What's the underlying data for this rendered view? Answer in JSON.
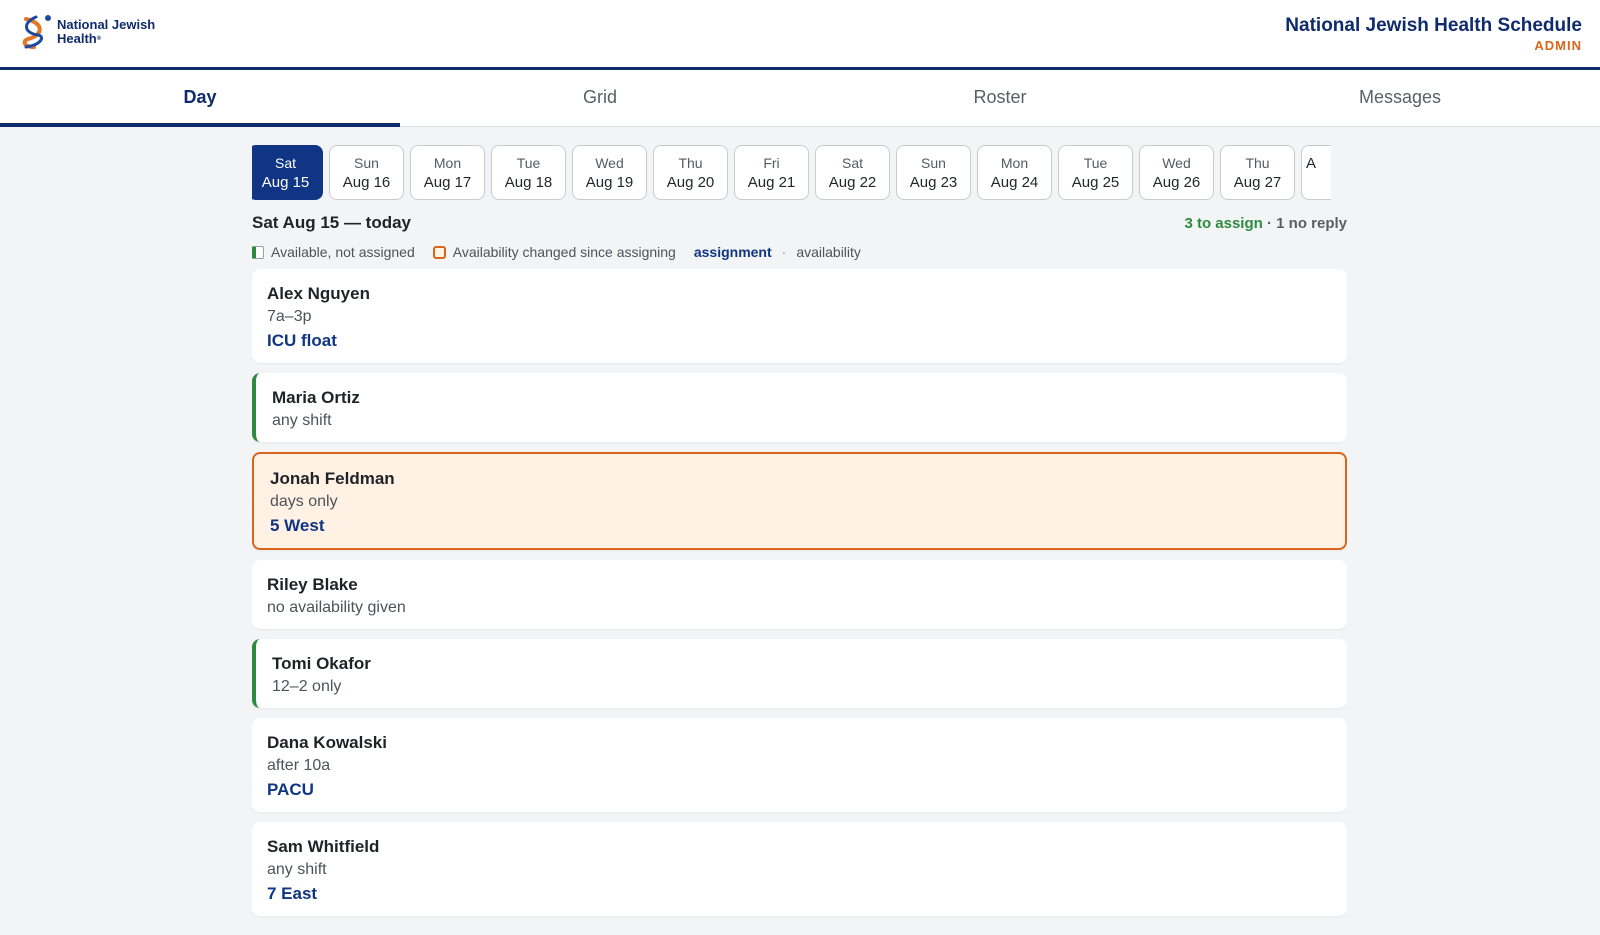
{
  "header": {
    "logo_line1": "National Jewish",
    "logo_line2": "Health",
    "logo_reg": "®",
    "title": "National Jewish Health Schedule",
    "role": "ADMIN"
  },
  "tabs": [
    {
      "label": "Day",
      "active": true
    },
    {
      "label": "Grid",
      "active": false
    },
    {
      "label": "Roster",
      "active": false
    },
    {
      "label": "Messages",
      "active": false
    }
  ],
  "dates": [
    {
      "dow": "Sat",
      "date": "Aug 15",
      "selected": true
    },
    {
      "dow": "Sun",
      "date": "Aug 16"
    },
    {
      "dow": "Mon",
      "date": "Aug 17"
    },
    {
      "dow": "Tue",
      "date": "Aug 18"
    },
    {
      "dow": "Wed",
      "date": "Aug 19"
    },
    {
      "dow": "Thu",
      "date": "Aug 20"
    },
    {
      "dow": "Fri",
      "date": "Aug 21"
    },
    {
      "dow": "Sat",
      "date": "Aug 22"
    },
    {
      "dow": "Sun",
      "date": "Aug 23"
    },
    {
      "dow": "Mon",
      "date": "Aug 24"
    },
    {
      "dow": "Tue",
      "date": "Aug 25"
    },
    {
      "dow": "Wed",
      "date": "Aug 26"
    },
    {
      "dow": "Thu",
      "date": "Aug 27"
    },
    {
      "dow": "",
      "date": "A",
      "partial": true
    }
  ],
  "day": {
    "heading": "Sat Aug 15 — today",
    "to_assign": "3 to assign",
    "separator": " · ",
    "no_reply": "1 no reply"
  },
  "legend": {
    "available_not_assigned": "Available, not assigned",
    "changed": "Availability changed since assigning",
    "assignment": "assignment",
    "dot": "·",
    "availability": "availability"
  },
  "staff": [
    {
      "name": "Alex Nguyen",
      "availability": "7a–3p",
      "assignment": "ICU float",
      "state": "assigned"
    },
    {
      "name": "Maria Ortiz",
      "availability": "any shift",
      "assignment": "",
      "state": "available"
    },
    {
      "name": "Jonah Feldman",
      "availability": "days only",
      "assignment": "5 West",
      "state": "changed"
    },
    {
      "name": "Riley Blake",
      "availability": "no availability given",
      "assignment": "",
      "state": "none"
    },
    {
      "name": "Tomi Okafor",
      "availability": "12–2 only",
      "assignment": "",
      "state": "available"
    },
    {
      "name": "Dana Kowalski",
      "availability": "after 10a",
      "assignment": "PACU",
      "state": "assigned"
    },
    {
      "name": "Sam Whitfield",
      "availability": "any shift",
      "assignment": "7 East",
      "state": "assigned"
    }
  ],
  "colors": {
    "brand_navy": "#0f2b6b",
    "selected_date": "#0f3584",
    "available_green": "#2e8a3e",
    "changed_orange": "#d9661c"
  }
}
